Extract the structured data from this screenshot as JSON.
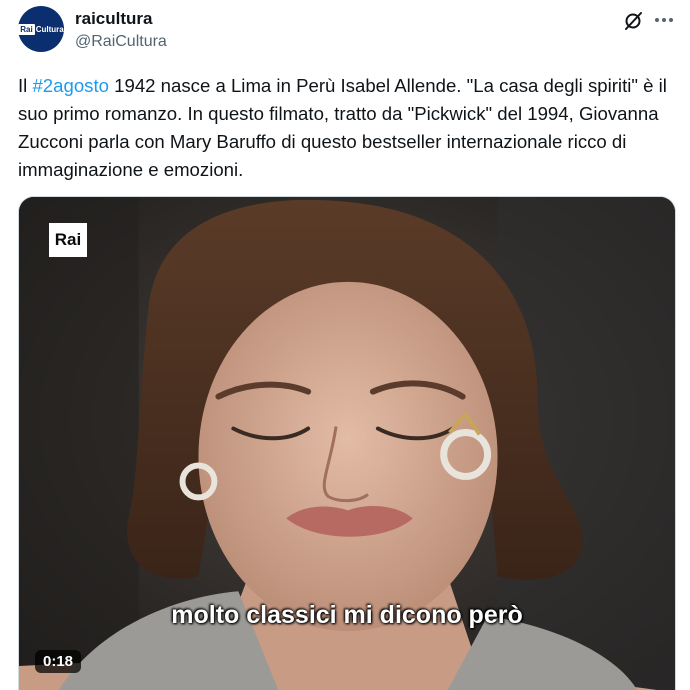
{
  "author": {
    "display_name": "raicultura",
    "handle": "@RaiCultura",
    "avatar": {
      "logo_rai": "Rai",
      "logo_text": "Cultura"
    }
  },
  "header_icons": {
    "grok": "grok-icon",
    "more": "more-icon"
  },
  "tweet": {
    "prefix": "Il ",
    "hashtag": "#2agosto",
    "body": " 1942 nasce a Lima in Perù Isabel Allende. \"La casa degli spiriti\" è il suo primo romanzo. In questo filmato, tratto da \"Pickwick\" del 1994, Giovanna Zucconi parla con Mary Baruffo di questo bestseller internazionale ricco di immaginazione e emozioni."
  },
  "video": {
    "channel_logo": "Rai",
    "subtitle": "molto classici mi dicono però",
    "duration": "0:18"
  },
  "colors": {
    "accent": "#1d9bf0",
    "avatar_bg": "#0b2e6e",
    "text": "#0f1419",
    "muted": "#536471"
  }
}
